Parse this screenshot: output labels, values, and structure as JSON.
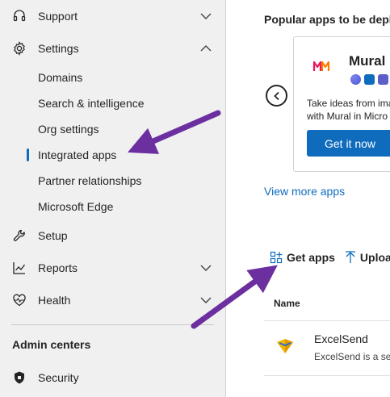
{
  "sidebar": {
    "items": [
      {
        "label": "Support",
        "icon": "headset-icon"
      },
      {
        "label": "Settings",
        "icon": "gear-icon"
      },
      {
        "label": "Setup",
        "icon": "wrench-icon"
      },
      {
        "label": "Reports",
        "icon": "chart-line-icon"
      },
      {
        "label": "Health",
        "icon": "heart-pulse-icon"
      }
    ],
    "settings_children": [
      {
        "label": "Domains"
      },
      {
        "label": "Search & intelligence"
      },
      {
        "label": "Org settings"
      },
      {
        "label": "Integrated apps",
        "active": true
      },
      {
        "label": "Partner relationships"
      },
      {
        "label": "Microsoft Edge"
      }
    ],
    "section_title": "Admin centers",
    "admin_centers": [
      {
        "label": "Security",
        "icon": "shield-icon"
      }
    ]
  },
  "main": {
    "popular_title": "Popular apps to be deplo",
    "card": {
      "app_name": "Mural",
      "description_line1": "Take ideas from ima",
      "description_line2": "with Mural in Micro",
      "cta_label": "Get it now"
    },
    "view_more": "View more apps",
    "toolbar": {
      "get_apps": "Get apps",
      "upload": "Uploa"
    },
    "table": {
      "columns": [
        "Name"
      ],
      "rows": [
        {
          "name": "ExcelSend",
          "description": "ExcelSend is a serv"
        }
      ]
    }
  },
  "colors": {
    "accent": "#0f6cbd",
    "annotation_arrow": "#6b2fa0",
    "sidebar_bg": "#f0f0f0"
  }
}
